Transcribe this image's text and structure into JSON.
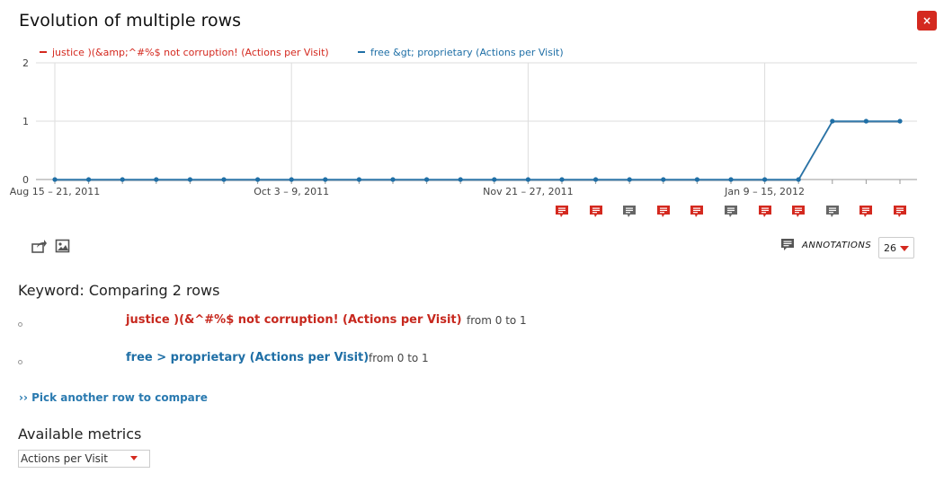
{
  "dialog": {
    "title": "Evolution of multiple rows",
    "close_label": "×"
  },
  "chart_data": {
    "type": "line",
    "ylim": [
      0,
      2
    ],
    "y_ticks": [
      "0",
      "1",
      "2"
    ],
    "x_tick_labels": [
      "Aug 15 – 21, 2011",
      "Oct 3 – 9, 2011",
      "Nov 21 – 27, 2011",
      "Jan 9 – 15, 2012"
    ],
    "grid": true,
    "legend_position": "top-left",
    "series": [
      {
        "name": "justice )(&amp;^#%$ not corruption! (Actions per Visit)",
        "color": "#d4291f",
        "values": [
          0,
          0,
          0,
          0,
          0,
          0,
          0,
          0,
          0,
          0,
          0,
          0,
          0,
          0,
          0,
          0,
          0,
          0,
          0,
          0,
          0,
          0,
          0,
          1,
          1,
          1
        ]
      },
      {
        "name": "free &gt; proprietary (Actions per Visit)",
        "color": "#1f6fa6",
        "values": [
          0,
          0,
          0,
          0,
          0,
          0,
          0,
          0,
          0,
          0,
          0,
          0,
          0,
          0,
          0,
          0,
          0,
          0,
          0,
          0,
          0,
          0,
          0,
          1,
          1,
          1
        ]
      }
    ],
    "annotation_marker_colors": [
      "#d4291f",
      "#d4291f",
      "#666666",
      "#d4291f",
      "#d4291f",
      "#666666",
      "#d4291f",
      "#d4291f",
      "#666666",
      "#d4291f",
      "#d4291f"
    ]
  },
  "toolbar": {
    "export_icon": "share-icon",
    "image_icon": "image-icon",
    "annotations_icon": "comment-icon",
    "annotations_label": "ANNOTATIONS",
    "periods_value": "26"
  },
  "comparison": {
    "heading": "Keyword: Comparing 2 rows",
    "rows": [
      {
        "label": "justice )(&^#%$ not corruption! (Actions per Visit)",
        "range": "from 0 to 1",
        "color": "#c7281e"
      },
      {
        "label": "free > proprietary (Actions per Visit)",
        "range": "from 0 to 1",
        "color": "#1f6fa6"
      }
    ],
    "pick_link": "›› Pick another row to compare"
  },
  "metrics": {
    "heading": "Available metrics",
    "selected": "Actions per Visit"
  }
}
